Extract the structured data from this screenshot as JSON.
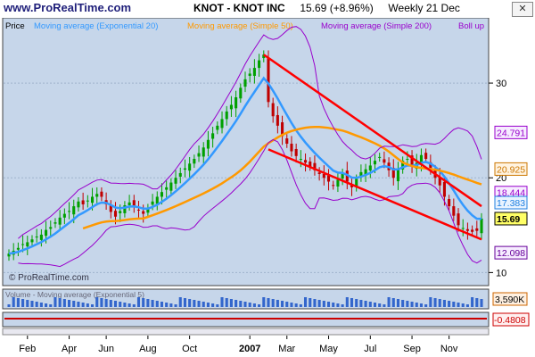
{
  "header": {
    "site": "www.ProRealTime.com",
    "symbol_title": "KNOT - KNOT INC",
    "last_price": "15.69",
    "change": "(+8.96%)",
    "period": "Weekly",
    "date": "21 Dec"
  },
  "legend": {
    "price": "Price",
    "ema": "Moving average (Exponential 20)",
    "sma50": "Moving average (Simple 50)",
    "sma200": "Moving average (Simple 200)",
    "boll": "Boll up"
  },
  "watermark": "© ProRealTime.com",
  "volume_legend": "Volume - Moving average (Exponential 5)",
  "colors": {
    "panel_bg": "#c6d6ea",
    "up": "#00a000",
    "down": "#c00000",
    "ema": "#3399ff",
    "sma50": "#ff9900",
    "boll": "#9900cc",
    "channel": "#ff0000"
  },
  "chart_data": {
    "type": "candlestick",
    "period": "weekly",
    "x_tick_labels": [
      "Feb",
      "Apr",
      "Jun",
      "Aug",
      "Oct",
      "2007",
      "Mar",
      "May",
      "Jul",
      "Sep",
      "Nov"
    ],
    "y_ticks": [
      10,
      20,
      30
    ],
    "ylim": [
      9,
      35
    ],
    "series": [
      {
        "name": "Price",
        "x": [
          "2006-01-06",
          "2006-01-13",
          "2006-01-20",
          "2006-01-27",
          "2006-02-03",
          "2006-02-10",
          "2006-02-17",
          "2006-02-24",
          "2006-03-03",
          "2006-03-10",
          "2006-03-17",
          "2006-03-24",
          "2006-03-31",
          "2006-04-07",
          "2006-04-14",
          "2006-04-21",
          "2006-04-28",
          "2006-05-05",
          "2006-05-12",
          "2006-05-19",
          "2006-05-26",
          "2006-06-02",
          "2006-06-09",
          "2006-06-16",
          "2006-06-23",
          "2006-06-30",
          "2006-07-07",
          "2006-07-14",
          "2006-07-21",
          "2006-07-28",
          "2006-08-04",
          "2006-08-11",
          "2006-08-18",
          "2006-08-25",
          "2006-09-01",
          "2006-09-08",
          "2006-09-15",
          "2006-09-22",
          "2006-09-29",
          "2006-10-06",
          "2006-10-13",
          "2006-10-20",
          "2006-10-27",
          "2006-11-03",
          "2006-11-10",
          "2006-11-17",
          "2006-11-24",
          "2006-12-01",
          "2006-12-08",
          "2006-12-15",
          "2006-12-22",
          "2006-12-29",
          "2007-01-05",
          "2007-01-12",
          "2007-01-19",
          "2007-01-26",
          "2007-02-02",
          "2007-02-09",
          "2007-02-16",
          "2007-02-23",
          "2007-03-02",
          "2007-03-09",
          "2007-03-16",
          "2007-03-23",
          "2007-03-30",
          "2007-04-06",
          "2007-04-13",
          "2007-04-20",
          "2007-04-27",
          "2007-05-04",
          "2007-05-11",
          "2007-05-18",
          "2007-05-25",
          "2007-06-01",
          "2007-06-08",
          "2007-06-15",
          "2007-06-22",
          "2007-06-29",
          "2007-07-06",
          "2007-07-13",
          "2007-07-20",
          "2007-07-27",
          "2007-08-03",
          "2007-08-10",
          "2007-08-17",
          "2007-08-24",
          "2007-08-31",
          "2007-09-07",
          "2007-09-14",
          "2007-09-21",
          "2007-09-28",
          "2007-10-05",
          "2007-10-12",
          "2007-10-19",
          "2007-10-26",
          "2007-11-02",
          "2007-11-09",
          "2007-11-16",
          "2007-11-23",
          "2007-11-30",
          "2007-12-07",
          "2007-12-14",
          "2007-12-21"
        ],
        "close": [
          12.0,
          12.3,
          12.6,
          13.0,
          13.2,
          13.5,
          13.8,
          14.0,
          14.5,
          14.8,
          15.3,
          15.8,
          16.2,
          16.5,
          17.0,
          17.5,
          17.2,
          17.6,
          18.0,
          18.3,
          18.0,
          17.2,
          16.4,
          15.9,
          16.5,
          17.1,
          17.4,
          17.0,
          16.6,
          16.2,
          16.8,
          17.5,
          18.0,
          18.5,
          19.0,
          19.5,
          20.0,
          20.5,
          21.0,
          21.5,
          22.0,
          22.6,
          23.2,
          24.0,
          24.7,
          25.5,
          26.2,
          27.0,
          27.7,
          28.5,
          29.5,
          30.4,
          31.0,
          31.6,
          32.4,
          33.0,
          28.0,
          26.5,
          25.5,
          24.4,
          23.6,
          22.8,
          22.3,
          22.0,
          21.6,
          21.2,
          20.8,
          20.4,
          20.0,
          19.6,
          19.2,
          19.8,
          20.4,
          19.6,
          19.0,
          19.9,
          20.6,
          20.9,
          21.3,
          21.8,
          22.2,
          21.6,
          20.8,
          20.0,
          21.0,
          21.8,
          22.0,
          21.2,
          21.6,
          22.4,
          22.0,
          20.9,
          20.0,
          19.2,
          18.0,
          17.0,
          16.0,
          15.0,
          14.7,
          14.4,
          14.3,
          14.4,
          15.69
        ]
      }
    ],
    "indicators": {
      "ema20_last": 17.383,
      "sma50_last": 20.925,
      "sma200_last": 12.098,
      "boll_up_last": 24.791,
      "boll_mid_last": 18.444
    },
    "volume": {
      "last": "3,590K"
    },
    "oscillator": {
      "last": "-0.4808"
    },
    "channel": {
      "upper": {
        "x": [
          "2007-01-26",
          "2007-12-21"
        ],
        "y": [
          33.0,
          17.0
        ]
      },
      "lower": {
        "x": [
          "2007-02-02",
          "2007-12-21"
        ],
        "y": [
          23.0,
          13.5
        ]
      }
    },
    "value_labels": [
      "24.791",
      "20.925",
      "18.444",
      "17.383",
      "15.69",
      "12.098"
    ]
  }
}
